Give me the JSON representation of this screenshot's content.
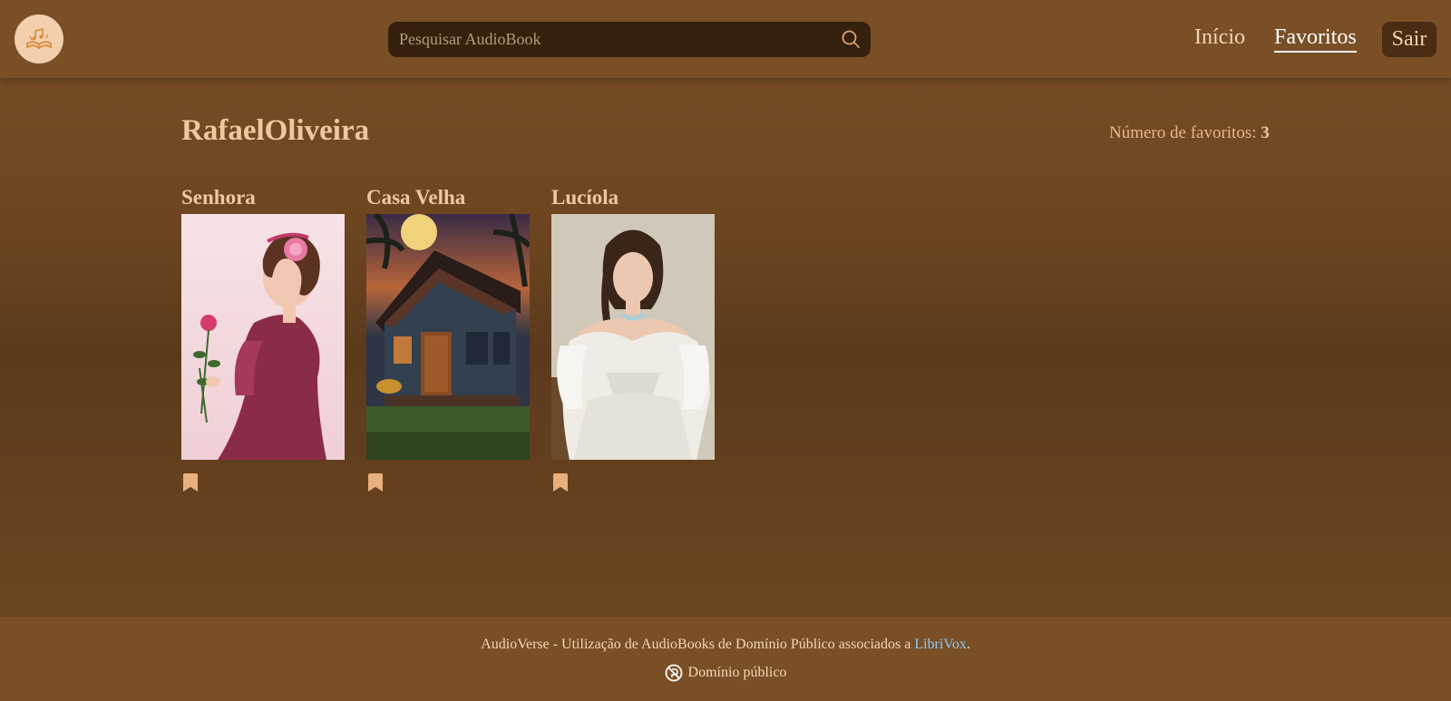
{
  "header": {
    "search_placeholder": "Pesquisar AudioBook",
    "nav": {
      "home": "Início",
      "favorites": "Favoritos",
      "logout": "Sair"
    }
  },
  "profile": {
    "username": "RafaelOliveira",
    "favorites_label": "Número de favoritos:",
    "favorites_count": "3"
  },
  "books": [
    {
      "title": "Senhora"
    },
    {
      "title": "Casa Velha"
    },
    {
      "title": "Lucíola"
    }
  ],
  "footer": {
    "text": "AudioVerse - Utilização de AudioBooks de Domínio Público associados a",
    "link": "LibriVox",
    "suffix": ".",
    "license": "Domínio público"
  },
  "colors": {
    "accent": "#f0c8a0",
    "header_bg": "#7a4f26",
    "search_bg": "#35200d",
    "link": "#8ec8f2"
  },
  "icons": [
    "book-music-logo-icon",
    "search-icon",
    "bookmark-icon",
    "public-domain-icon"
  ]
}
